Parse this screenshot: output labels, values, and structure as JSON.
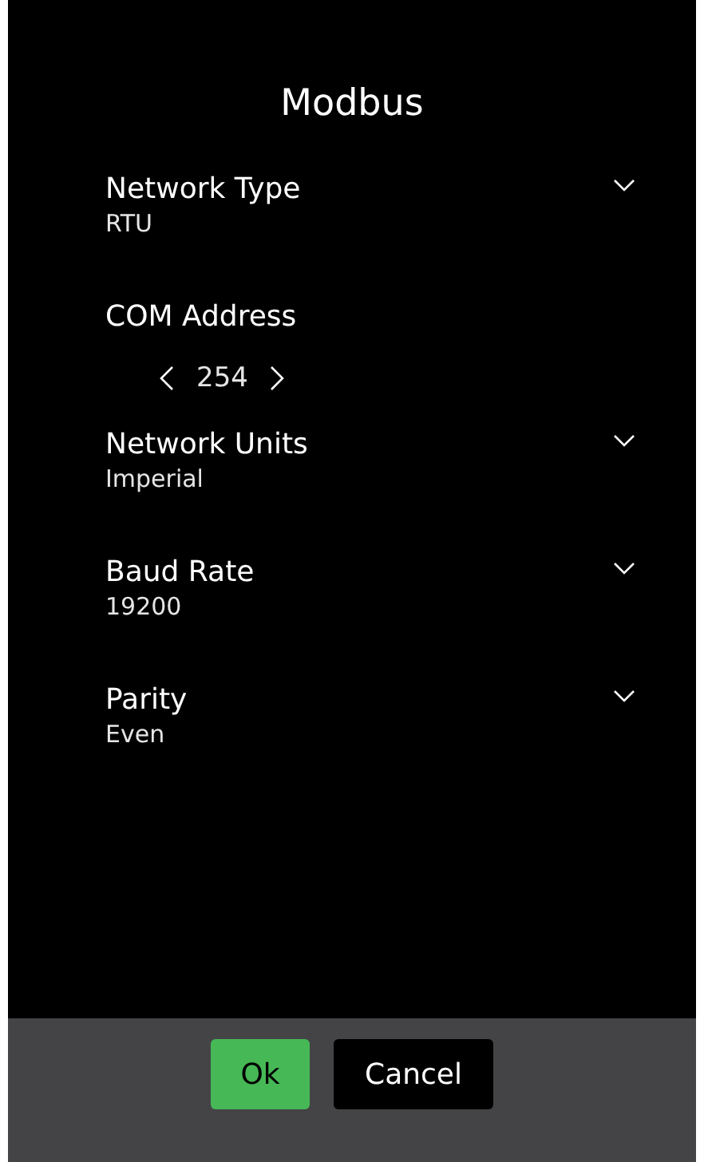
{
  "title": "Modbus",
  "settings": [
    {
      "kind": "dropdown",
      "label": "Network Type",
      "value": "RTU"
    },
    {
      "kind": "stepper",
      "label": "COM Address",
      "value": "254"
    },
    {
      "kind": "dropdown",
      "label": "Network Units",
      "value": "Imperial"
    },
    {
      "kind": "dropdown",
      "label": "Baud Rate",
      "value": "19200"
    },
    {
      "kind": "dropdown",
      "label": "Parity",
      "value": "Even"
    }
  ],
  "buttons": [
    {
      "kind": "primary",
      "label": "Ok"
    },
    {
      "kind": "secondary",
      "label": "Cancel"
    }
  ]
}
